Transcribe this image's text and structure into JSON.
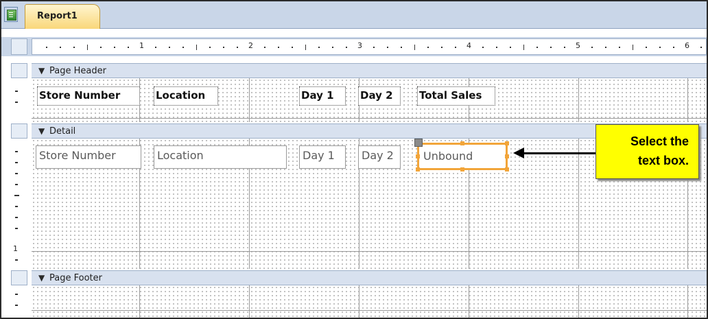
{
  "tabs": [
    {
      "label": "Report1"
    }
  ],
  "ruler": {
    "numbers": [
      "1",
      "2",
      "3",
      "4",
      "5",
      "6"
    ]
  },
  "vertical_ruler": {
    "numbers": [
      "1"
    ]
  },
  "sections": {
    "page_header": {
      "label": "Page Header",
      "controls": [
        "Store Number",
        "Location",
        "Day 1",
        "Day 2",
        "Total Sales"
      ]
    },
    "detail": {
      "label": "Detail",
      "controls": [
        "Store Number",
        "Location",
        "Day 1",
        "Day 2",
        "Unbound"
      ]
    },
    "page_footer": {
      "label": "Page Footer"
    }
  },
  "callout": {
    "line1": "Select the",
    "line2": "text box."
  },
  "colors": {
    "selection": "#f2a53a",
    "callout": "#ffff00",
    "band": "#d8e1ef",
    "tab_active": "#f9d77a"
  },
  "icons": {
    "tab": "report-icon",
    "band": "section-collapse-icon",
    "callout": "arrow-left-icon"
  }
}
